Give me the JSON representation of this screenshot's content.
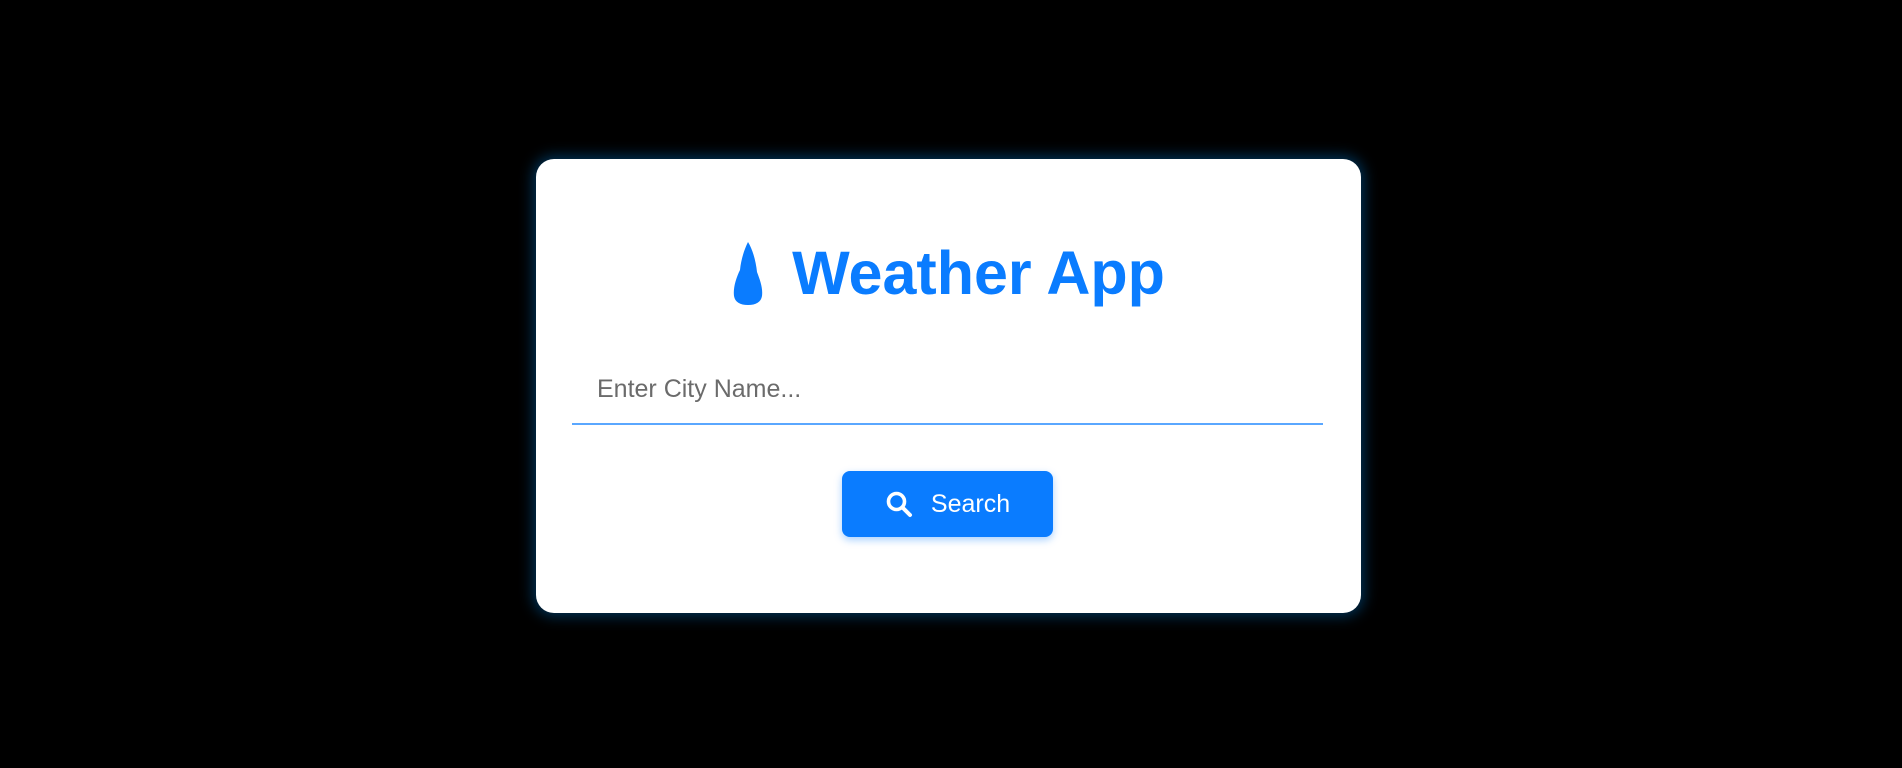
{
  "app": {
    "title": "Weather App",
    "title_icon": "water-drop-icon",
    "accent_color": "#0a7cff",
    "background_color": "#000000",
    "card_color": "#ffffff"
  },
  "search": {
    "placeholder": "Enter City Name...",
    "value": "",
    "button_label": "Search",
    "button_icon": "search-icon"
  }
}
